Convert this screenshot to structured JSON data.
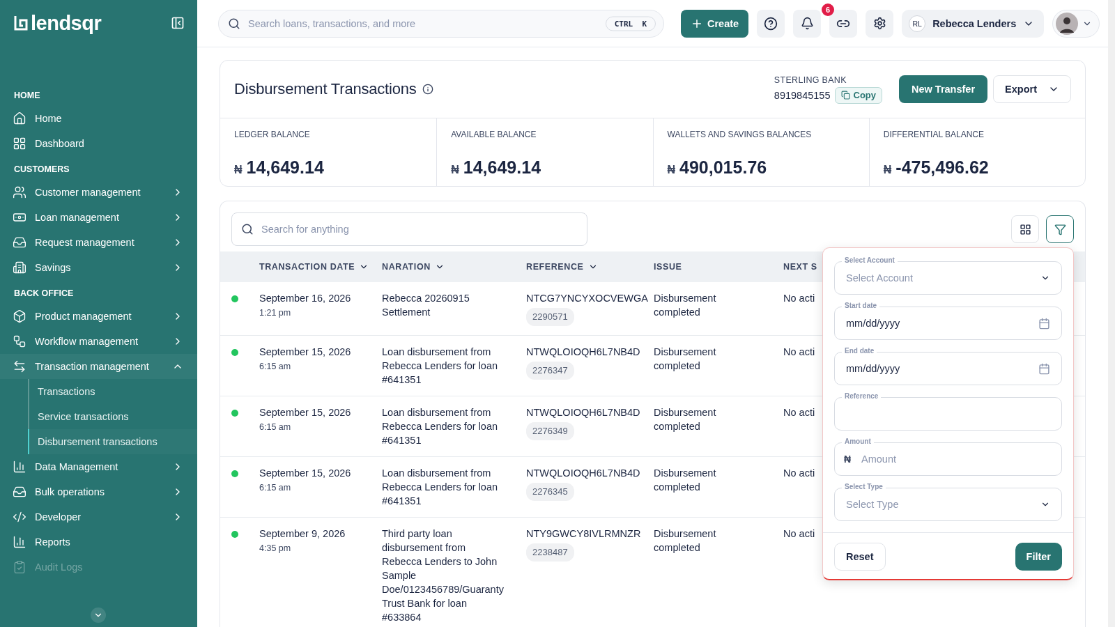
{
  "sidebar": {
    "logo": "lendsqr",
    "groups": [
      {
        "title": "HOME",
        "items": [
          {
            "label": "Home",
            "expandable": false,
            "disabled": false
          },
          {
            "label": "Dashboard",
            "expandable": false,
            "disabled": false
          }
        ]
      },
      {
        "title": "CUSTOMERS",
        "items": [
          {
            "label": "Customer management",
            "expandable": true,
            "expanded": false,
            "disabled": false
          },
          {
            "label": "Loan management",
            "expandable": true,
            "expanded": false,
            "disabled": false
          },
          {
            "label": "Request management",
            "expandable": true,
            "expanded": false,
            "disabled": false
          },
          {
            "label": "Savings",
            "expandable": true,
            "expanded": false,
            "disabled": false
          }
        ]
      },
      {
        "title": "BACK OFFICE",
        "items": [
          {
            "label": "Product management",
            "expandable": true,
            "expanded": false,
            "disabled": false
          },
          {
            "label": "Workflow management",
            "expandable": true,
            "expanded": false,
            "disabled": false
          },
          {
            "label": "Transaction management",
            "expandable": true,
            "expanded": true,
            "disabled": false,
            "children": [
              {
                "label": "Transactions",
                "selected": false
              },
              {
                "label": "Service transactions",
                "selected": false
              },
              {
                "label": "Disbursement transactions",
                "selected": true
              }
            ]
          },
          {
            "label": "Data Management",
            "expandable": true,
            "expanded": false,
            "disabled": false
          },
          {
            "label": "Bulk operations",
            "expandable": true,
            "expanded": false,
            "disabled": false
          },
          {
            "label": "Developer",
            "expandable": true,
            "expanded": false,
            "disabled": false
          },
          {
            "label": "Reports",
            "expandable": false,
            "disabled": false
          },
          {
            "label": "Audit Logs",
            "expandable": false,
            "disabled": true
          }
        ]
      }
    ]
  },
  "topbar": {
    "search": {
      "placeholder": "Search loans, transactions, and more",
      "shortcut": "CTRL  K"
    },
    "create_button": "Create",
    "notifications": "6",
    "user": {
      "initials": "RL",
      "name": "Rebecca Lenders"
    }
  },
  "header": {
    "title": "Disbursement Transactions",
    "bank": "STERLING BANK",
    "account_number": "8919845155",
    "copy": "Copy",
    "new_transfer": "New Transfer",
    "export": "Export",
    "balances": [
      {
        "label": "LEDGER BALANCE",
        "currency": "₦",
        "amount": "14,649.14"
      },
      {
        "label": "AVAILABLE BALANCE",
        "currency": "₦",
        "amount": "14,649.14"
      },
      {
        "label": "WALLETS AND SAVINGS BALANCES",
        "currency": "₦",
        "amount": "490,015.76"
      },
      {
        "label": "DIFFERENTIAL BALANCE",
        "currency": "₦",
        "amount": "-475,496.62"
      }
    ]
  },
  "table": {
    "search": {
      "placeholder": "Search for anything"
    },
    "columns": [
      {
        "label": "TRANSACTION DATE",
        "sortable": true
      },
      {
        "label": "NARATION",
        "sortable": true
      },
      {
        "label": "REFERENCE",
        "sortable": true
      },
      {
        "label": "ISSUE",
        "sortable": false
      },
      {
        "label": "NEXT S",
        "sortable": false
      }
    ],
    "rows": [
      {
        "date": "September 16, 2026",
        "time": "1:21 pm",
        "naration": "Rebecca 20260915 Settlement",
        "reference": "NTCG7YNCYXOCVEWGA",
        "ref_id": "2290571",
        "issue": "Disbursement completed",
        "next": "No acti"
      },
      {
        "date": "September 15, 2026",
        "time": "6:15 am",
        "naration": "Loan disbursement from Rebecca Lenders for loan #641351",
        "reference": "NTWQLOIOQH6L7NB4D",
        "ref_id": "2276347",
        "issue": "Disbursement completed",
        "next": "No acti"
      },
      {
        "date": "September 15, 2026",
        "time": "6:15 am",
        "naration": "Loan disbursement from Rebecca Lenders for loan #641351",
        "reference": "NTWQLOIOQH6L7NB4D",
        "ref_id": "2276349",
        "issue": "Disbursement completed",
        "next": "No acti"
      },
      {
        "date": "September 15, 2026",
        "time": "6:15 am",
        "naration": "Loan disbursement from Rebecca Lenders for loan #641351",
        "reference": "NTWQLOIOQH6L7NB4D",
        "ref_id": "2276345",
        "issue": "Disbursement completed",
        "next": "No acti"
      },
      {
        "date": "September 9, 2026",
        "time": "4:35 pm",
        "naration": "Third party loan disbursement from Rebecca Lenders to John Sample Doe/0123456789/Guaranty Trust Bank for loan #633864",
        "reference": "NTY9GWCY8IVLRMNZR",
        "ref_id": "2238487",
        "issue": "Disbursement completed",
        "next": "No acti"
      }
    ]
  },
  "filter_panel": {
    "fields": [
      {
        "kind": "select",
        "label": "Select Account",
        "placeholder": "Select Account"
      },
      {
        "kind": "date",
        "label": "Start date",
        "value": "mm/dd/yyyy"
      },
      {
        "kind": "date",
        "label": "End date",
        "value": "mm/dd/yyyy"
      },
      {
        "kind": "text",
        "label": "Reference"
      },
      {
        "kind": "amount",
        "label": "Amount",
        "prefix": "₦",
        "placeholder": "Amount"
      },
      {
        "kind": "select",
        "label": "Select Type",
        "placeholder": "Select Type"
      }
    ],
    "reset": "Reset",
    "filter": "Filter"
  }
}
